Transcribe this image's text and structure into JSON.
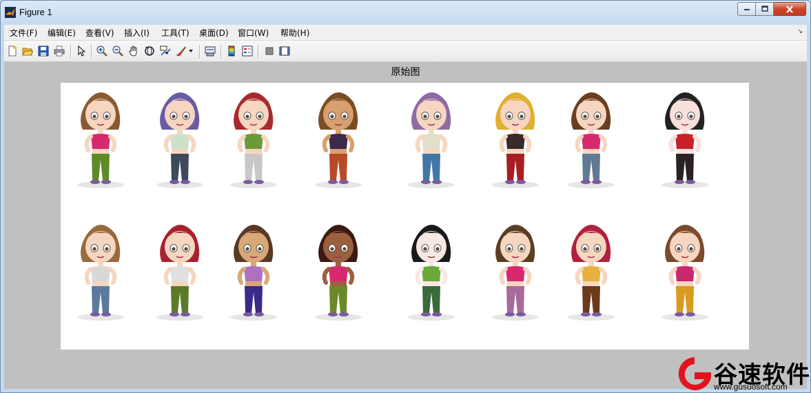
{
  "window": {
    "title": "Figure 1",
    "buttons": [
      "minimize",
      "maximize",
      "close"
    ]
  },
  "menubar": {
    "items": [
      {
        "label": "文件(F)"
      },
      {
        "label": "编辑(E)"
      },
      {
        "label": "查看(V)"
      },
      {
        "label": "插入(I)"
      },
      {
        "label": "工具(T)"
      },
      {
        "label": "桌面(D)"
      },
      {
        "label": "窗口(W)"
      },
      {
        "label": "帮助(H)"
      }
    ]
  },
  "toolbar": {
    "buttons": [
      "new-figure-icon",
      "open-file-icon",
      "save-icon",
      "print-icon",
      "edit-plot-arrow-icon",
      "zoom-in-icon",
      "zoom-out-icon",
      "pan-hand-icon",
      "rotate-3d-icon",
      "data-cursor-icon",
      "brush-icon",
      "link-plot-icon",
      "colorbar-icon",
      "legend-icon",
      "hide-plot-tools-icon",
      "show-plot-tools-icon"
    ]
  },
  "figure": {
    "title": "原始图",
    "image_description_grid": {
      "rows": 2,
      "columns": 8
    },
    "characters": [
      {
        "hair": "#8a5a36",
        "skin": "#f6d6c0",
        "top": "#d8286e",
        "pants": "#5f8a2a"
      },
      {
        "hair": "#6a5ba6",
        "skin": "#f6d6c0",
        "top": "#cfe0c8",
        "pants": "#3c4a5a"
      },
      {
        "hair": "#a82a2e",
        "skin": "#f6d6c0",
        "top": "#6b9a3a",
        "pants": "#c8c8c8"
      },
      {
        "hair": "#7a4e22",
        "skin": "#d8a070",
        "top": "#3d2a4a",
        "pants": "#b84a28"
      },
      {
        "hair": "#8e6aa6",
        "skin": "#f6d6c0",
        "top": "#e0dfcc",
        "pants": "#3f78a8"
      },
      {
        "hair": "#e0b030",
        "skin": "#f6d6c0",
        "top": "#3a2a2a",
        "pants": "#a81e22"
      },
      {
        "hair": "#6a3e22",
        "skin": "#f6d6c0",
        "top": "#d8286e",
        "pants": "#607a94"
      },
      {
        "hair": "#222222",
        "skin": "#f8e0dc",
        "top": "#c8202a",
        "pants": "#2a2222"
      },
      {
        "hair": "#9a6a3c",
        "skin": "#f6d6c0",
        "top": "#d8d8d8",
        "pants": "#5a7aa0"
      },
      {
        "hair": "#a8222e",
        "skin": "#f6d6c0",
        "top": "#e0e0e0",
        "pants": "#5a7a2a"
      },
      {
        "hair": "#5a3a22",
        "skin": "#d8a878",
        "top": "#b070c0",
        "pants": "#3a2a8a"
      },
      {
        "hair": "#3a1a12",
        "skin": "#9a6040",
        "top": "#d8286e",
        "pants": "#6a8a2a"
      },
      {
        "hair": "#1a1a1a",
        "skin": "#f8e8e4",
        "top": "#6aa83a",
        "pants": "#3a6a3a"
      },
      {
        "hair": "#5a3e22",
        "skin": "#f6d6c0",
        "top": "#d8286e",
        "pants": "#a86a9a"
      },
      {
        "hair": "#b02040",
        "skin": "#f6d6c0",
        "top": "#e8b040",
        "pants": "#6a3a1a"
      },
      {
        "hair": "#7a4a2a",
        "skin": "#f6d6c0",
        "top": "#c8286e",
        "pants": "#d89a20"
      }
    ]
  },
  "watermark": {
    "text": "谷速软件",
    "url": "www.gusuosoft.com",
    "accent": "#e1141e"
  },
  "colors": {
    "titlebar": "#c3d9ef",
    "canvas_bg": "#c0c0c0",
    "axes_bg": "#ffffff",
    "close_button": "#c9462c"
  }
}
